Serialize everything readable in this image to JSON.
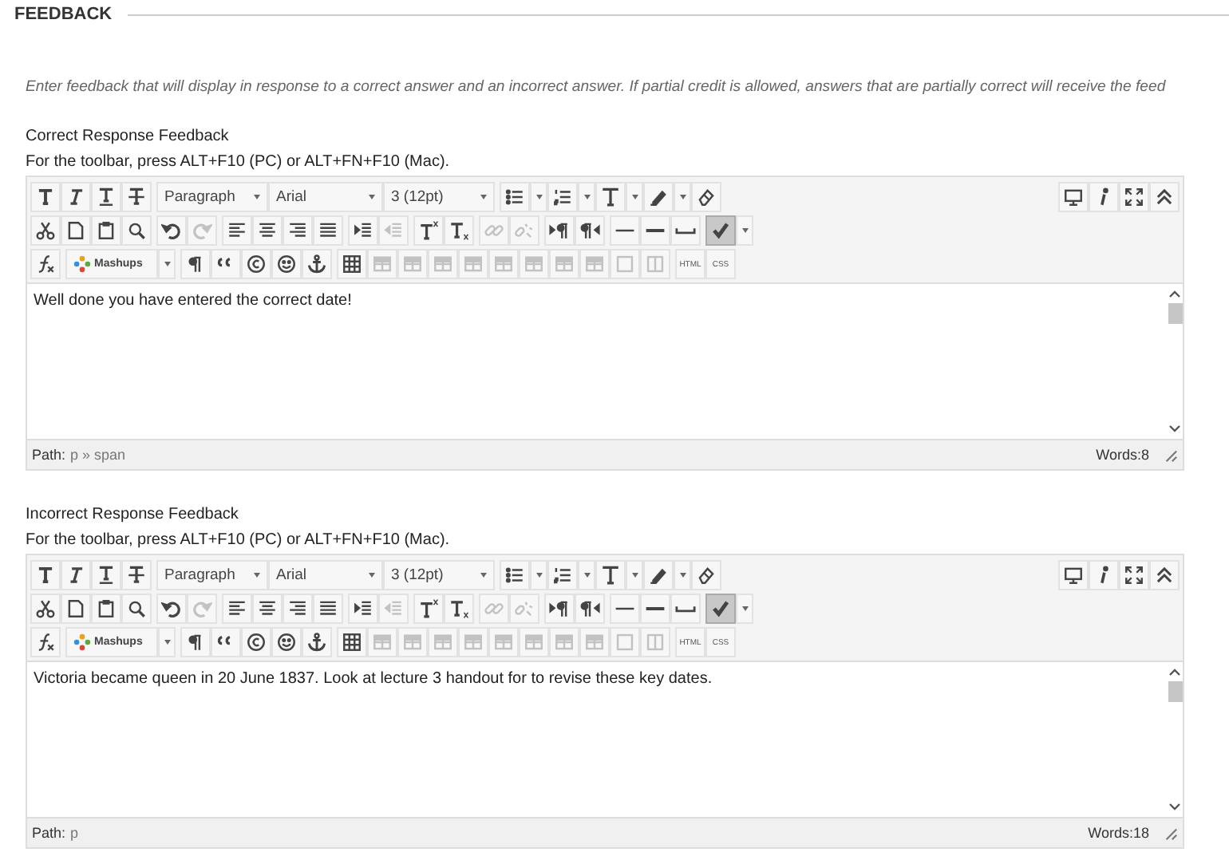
{
  "section": {
    "title": "FEEDBACK"
  },
  "intro": "Enter feedback that will display in response to a correct answer and an incorrect answer. If partial credit is allowed, answers that are partially correct will receive the feed",
  "editors": [
    {
      "label": "Correct Response Feedback",
      "hint": "For the toolbar, press ALT+F10 (PC) or ALT+FN+F10 (Mac).",
      "toolbar": [
        {
          "groups": [
            [
              {
                "kind": "bold",
                "disabled": false,
                "active": false
              },
              {
                "kind": "italic",
                "disabled": false,
                "active": false
              },
              {
                "kind": "underline",
                "disabled": false,
                "active": false
              },
              {
                "kind": "strike",
                "disabled": false,
                "active": false
              }
            ],
            [
              {
                "kind": "format_dropdown",
                "label": "Paragraph"
              },
              {
                "kind": "font_dropdown",
                "label": "Arial"
              },
              {
                "kind": "size_dropdown",
                "label": "3 (12pt)"
              }
            ],
            [
              {
                "kind": "bullets",
                "disabled": false,
                "active": false,
                "menu": true
              },
              {
                "kind": "numbers",
                "disabled": false,
                "active": false,
                "menu": true
              },
              {
                "kind": "text_color",
                "disabled": false,
                "active": false,
                "menu": true
              },
              {
                "kind": "highlight",
                "disabled": false,
                "active": false,
                "menu": true
              },
              {
                "kind": "eraser",
                "disabled": false,
                "active": false
              }
            ]
          ],
          "end_groups": [
            [
              {
                "kind": "preview",
                "disabled": false,
                "active": false
              },
              {
                "kind": "info",
                "disabled": false,
                "active": false
              },
              {
                "kind": "fullscreen",
                "disabled": false,
                "active": false
              },
              {
                "kind": "collapse",
                "disabled": false,
                "active": false
              }
            ]
          ]
        },
        {
          "groups": [
            [
              {
                "kind": "cut",
                "disabled": false,
                "active": false
              },
              {
                "kind": "new_doc",
                "disabled": false,
                "active": false
              },
              {
                "kind": "paste",
                "disabled": false,
                "active": false
              },
              {
                "kind": "find",
                "disabled": false,
                "active": false
              }
            ],
            [
              {
                "kind": "undo",
                "disabled": false,
                "active": false
              },
              {
                "kind": "redo",
                "disabled": true,
                "active": false
              }
            ],
            [
              {
                "kind": "align_left",
                "disabled": false,
                "active": false
              },
              {
                "kind": "align_center",
                "disabled": false,
                "active": false
              },
              {
                "kind": "align_right",
                "disabled": false,
                "active": false
              },
              {
                "kind": "justify",
                "disabled": false,
                "active": false
              }
            ],
            [
              {
                "kind": "indent",
                "disabled": false,
                "active": false
              },
              {
                "kind": "outdent",
                "disabled": true,
                "active": false
              }
            ],
            [
              {
                "kind": "superscript",
                "disabled": false,
                "active": false
              },
              {
                "kind": "subscript",
                "disabled": false,
                "active": false
              }
            ],
            [
              {
                "kind": "link",
                "disabled": true,
                "active": false
              },
              {
                "kind": "unlink",
                "disabled": true,
                "active": false
              }
            ],
            [
              {
                "kind": "ltr",
                "disabled": false,
                "active": false
              },
              {
                "kind": "rtl",
                "disabled": false,
                "active": false
              }
            ],
            [
              {
                "kind": "hr",
                "disabled": false,
                "active": false
              },
              {
                "kind": "hr_thick",
                "disabled": false,
                "active": false
              },
              {
                "kind": "nbsp",
                "disabled": false,
                "active": false
              }
            ],
            [
              {
                "kind": "spellcheck",
                "disabled": false,
                "active": true,
                "menu": true
              }
            ]
          ]
        },
        {
          "groups": [
            [
              {
                "kind": "formula",
                "disabled": false,
                "active": false
              }
            ],
            [
              {
                "kind": "mashups",
                "label": "Mashups"
              }
            ],
            [
              {
                "kind": "pilcrow",
                "disabled": false,
                "active": false
              },
              {
                "kind": "quote",
                "disabled": false,
                "active": false
              },
              {
                "kind": "copyright",
                "disabled": false,
                "active": false
              },
              {
                "kind": "emoticon",
                "disabled": false,
                "active": false
              },
              {
                "kind": "anchor",
                "disabled": false,
                "active": false
              }
            ],
            [
              {
                "kind": "table",
                "disabled": false,
                "active": false
              },
              {
                "kind": "table_op",
                "disabled": true,
                "active": false
              },
              {
                "kind": "table_op",
                "disabled": true,
                "active": false
              },
              {
                "kind": "table_op",
                "disabled": true,
                "active": false
              },
              {
                "kind": "table_op",
                "disabled": true,
                "active": false
              },
              {
                "kind": "table_op",
                "disabled": true,
                "active": false
              },
              {
                "kind": "table_op",
                "disabled": true,
                "active": false
              },
              {
                "kind": "table_op",
                "disabled": true,
                "active": false
              },
              {
                "kind": "table_op",
                "disabled": true,
                "active": false
              },
              {
                "kind": "split_cells",
                "disabled": true,
                "active": false
              },
              {
                "kind": "merge_cells",
                "disabled": true,
                "active": false
              }
            ],
            [
              {
                "kind": "text",
                "label": "HTML"
              },
              {
                "kind": "text",
                "label": "CSS"
              }
            ]
          ]
        }
      ],
      "content": "Well done you have entered the correct date!",
      "path_label": "Path:",
      "path": "p » span",
      "words": "Words:8"
    },
    {
      "label": "Incorrect Response Feedback",
      "hint": "For the toolbar, press ALT+F10 (PC) or ALT+FN+F10 (Mac).",
      "toolbar": [
        {
          "groups": [
            [
              {
                "kind": "bold",
                "disabled": false,
                "active": false
              },
              {
                "kind": "italic",
                "disabled": false,
                "active": false
              },
              {
                "kind": "underline",
                "disabled": false,
                "active": false
              },
              {
                "kind": "strike",
                "disabled": false,
                "active": false
              }
            ],
            [
              {
                "kind": "format_dropdown",
                "label": "Paragraph"
              },
              {
                "kind": "font_dropdown",
                "label": "Arial"
              },
              {
                "kind": "size_dropdown",
                "label": "3 (12pt)"
              }
            ],
            [
              {
                "kind": "bullets",
                "disabled": false,
                "active": false,
                "menu": true
              },
              {
                "kind": "numbers",
                "disabled": false,
                "active": false,
                "menu": true
              },
              {
                "kind": "text_color",
                "disabled": false,
                "active": false,
                "menu": true
              },
              {
                "kind": "highlight",
                "disabled": false,
                "active": false,
                "menu": true
              },
              {
                "kind": "eraser",
                "disabled": false,
                "active": false
              }
            ]
          ],
          "end_groups": [
            [
              {
                "kind": "preview",
                "disabled": false,
                "active": false
              },
              {
                "kind": "info",
                "disabled": false,
                "active": false
              },
              {
                "kind": "fullscreen",
                "disabled": false,
                "active": false
              },
              {
                "kind": "collapse",
                "disabled": false,
                "active": false
              }
            ]
          ]
        },
        {
          "groups": [
            [
              {
                "kind": "cut",
                "disabled": false,
                "active": false
              },
              {
                "kind": "new_doc",
                "disabled": false,
                "active": false
              },
              {
                "kind": "paste",
                "disabled": false,
                "active": false
              },
              {
                "kind": "find",
                "disabled": false,
                "active": false
              }
            ],
            [
              {
                "kind": "undo",
                "disabled": false,
                "active": false
              },
              {
                "kind": "redo",
                "disabled": true,
                "active": false
              }
            ],
            [
              {
                "kind": "align_left",
                "disabled": false,
                "active": false
              },
              {
                "kind": "align_center",
                "disabled": false,
                "active": false
              },
              {
                "kind": "align_right",
                "disabled": false,
                "active": false
              },
              {
                "kind": "justify",
                "disabled": false,
                "active": false
              }
            ],
            [
              {
                "kind": "indent",
                "disabled": false,
                "active": false
              },
              {
                "kind": "outdent",
                "disabled": true,
                "active": false
              }
            ],
            [
              {
                "kind": "superscript",
                "disabled": false,
                "active": false
              },
              {
                "kind": "subscript",
                "disabled": false,
                "active": false
              }
            ],
            [
              {
                "kind": "link",
                "disabled": true,
                "active": false
              },
              {
                "kind": "unlink",
                "disabled": true,
                "active": false
              }
            ],
            [
              {
                "kind": "ltr",
                "disabled": false,
                "active": false
              },
              {
                "kind": "rtl",
                "disabled": false,
                "active": false
              }
            ],
            [
              {
                "kind": "hr",
                "disabled": false,
                "active": false
              },
              {
                "kind": "hr_thick",
                "disabled": false,
                "active": false
              },
              {
                "kind": "nbsp",
                "disabled": false,
                "active": false
              }
            ],
            [
              {
                "kind": "spellcheck",
                "disabled": false,
                "active": true,
                "menu": true
              }
            ]
          ]
        },
        {
          "groups": [
            [
              {
                "kind": "formula",
                "disabled": false,
                "active": false
              }
            ],
            [
              {
                "kind": "mashups",
                "label": "Mashups"
              }
            ],
            [
              {
                "kind": "pilcrow",
                "disabled": false,
                "active": false
              },
              {
                "kind": "quote",
                "disabled": false,
                "active": false
              },
              {
                "kind": "copyright",
                "disabled": false,
                "active": false
              },
              {
                "kind": "emoticon",
                "disabled": false,
                "active": false
              },
              {
                "kind": "anchor",
                "disabled": false,
                "active": false
              }
            ],
            [
              {
                "kind": "table",
                "disabled": false,
                "active": false
              },
              {
                "kind": "table_op",
                "disabled": true,
                "active": false
              },
              {
                "kind": "table_op",
                "disabled": true,
                "active": false
              },
              {
                "kind": "table_op",
                "disabled": true,
                "active": false
              },
              {
                "kind": "table_op",
                "disabled": true,
                "active": false
              },
              {
                "kind": "table_op",
                "disabled": true,
                "active": false
              },
              {
                "kind": "table_op",
                "disabled": true,
                "active": false
              },
              {
                "kind": "table_op",
                "disabled": true,
                "active": false
              },
              {
                "kind": "table_op",
                "disabled": true,
                "active": false
              },
              {
                "kind": "split_cells",
                "disabled": true,
                "active": false
              },
              {
                "kind": "merge_cells",
                "disabled": true,
                "active": false
              }
            ],
            [
              {
                "kind": "text",
                "label": "HTML"
              },
              {
                "kind": "text",
                "label": "CSS"
              }
            ]
          ]
        }
      ],
      "content": "Victoria became queen in 20 June 1837. Look at lecture 3 handout for to revise these key dates.",
      "path_label": "Path:",
      "path": "p",
      "words": "Words:18"
    }
  ]
}
